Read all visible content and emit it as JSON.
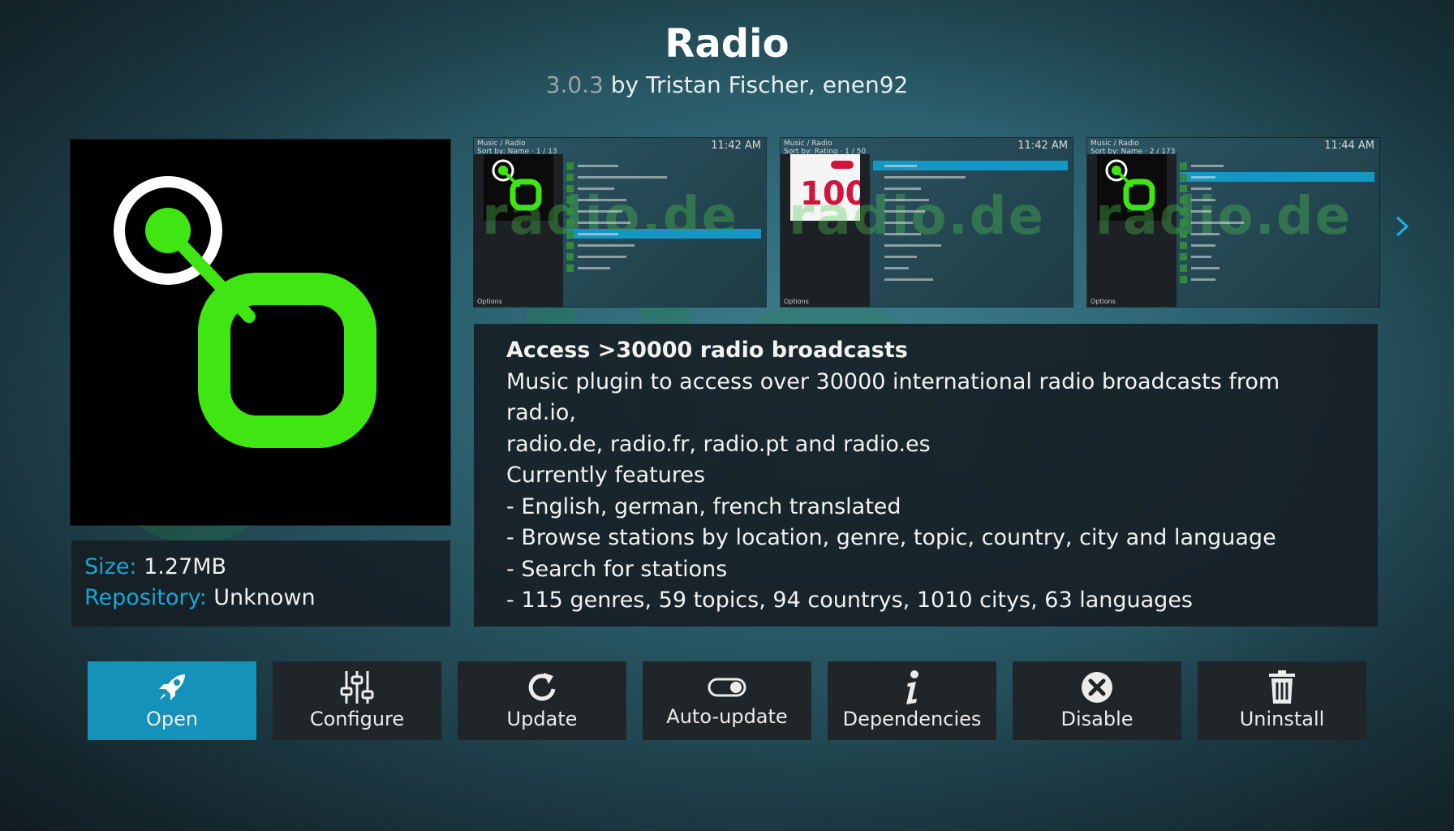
{
  "header": {
    "title": "Radio",
    "version": "3.0.3",
    "author_text": " by Tristan Fischer, enen92"
  },
  "icon": {
    "name": "radio-logo-icon",
    "accent_color": "#3fe612"
  },
  "info": {
    "size_label": "Size:",
    "size_value": "1.27MB",
    "repository_label": "Repository:",
    "repository_value": "Unknown"
  },
  "screenshots": [
    {
      "path_text": "Music / Radio",
      "sort_text": "Sort by: Name · 1 / 13",
      "time": "11:42 AM",
      "footer": "Options",
      "watermark": "radio.de"
    },
    {
      "path_text": "Music / Radio",
      "sort_text": "Sort by: Rating · 1 / 50",
      "time": "11:42 AM",
      "footer": "Options",
      "watermark": "radio.de"
    },
    {
      "path_text": "Music / Radio",
      "sort_text": "Sort by: Name · 2 / 173",
      "time": "11:44 AM",
      "footer": "Options",
      "watermark": "radio.de"
    }
  ],
  "description": {
    "headline": "Access >30000 radio broadcasts",
    "lines": [
      "Music plugin to access over 30000 international radio broadcasts from rad.io,",
      "radio.de, radio.fr, radio.pt and radio.es",
      "Currently features",
      "- English, german, french translated",
      "- Browse stations by location, genre, topic, country, city and language",
      "- Search for stations",
      "- 115 genres, 59 topics, 94 countrys, 1010 citys, 63 languages"
    ]
  },
  "buttons": [
    {
      "label": "Open",
      "icon": "rocket-icon"
    },
    {
      "label": "Configure",
      "icon": "sliders-icon"
    },
    {
      "label": "Update",
      "icon": "refresh-icon"
    },
    {
      "label": "Auto-update",
      "icon": "toggle-icon"
    },
    {
      "label": "Dependencies",
      "icon": "info-icon"
    },
    {
      "label": "Disable",
      "icon": "close-circle-icon"
    },
    {
      "label": "Uninstall",
      "icon": "trash-icon"
    }
  ],
  "colors": {
    "accent_blue": "#1592ba",
    "label_blue": "#17a6d6",
    "logo_green": "#3fe612"
  }
}
